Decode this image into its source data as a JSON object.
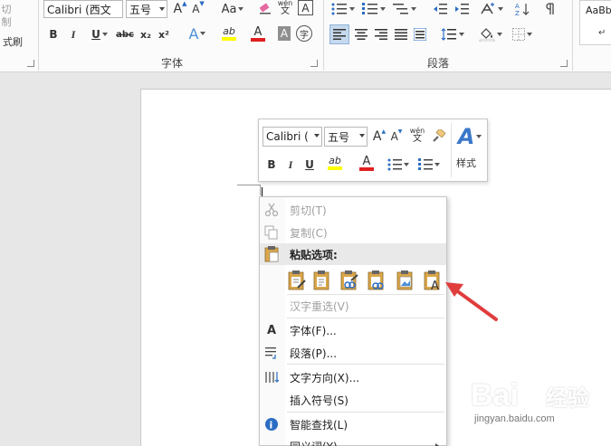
{
  "ribbon": {
    "clipboard_partial": {
      "cut": "切",
      "copy": "制",
      "format_painter": "式刷"
    },
    "font": {
      "font_name": "Calibri (西文",
      "font_size": "五号",
      "grow_label": "A",
      "shrink_label": "A",
      "change_case_label": "Aa",
      "phonetic_top": "wén",
      "phonetic_bottom": "文",
      "border_char_label": "A",
      "bold": "B",
      "italic": "I",
      "underline": "U",
      "strikethrough": "abc",
      "subscript": "x₂",
      "superscript": "x²",
      "text_effects": "A",
      "highlight": "ab",
      "font_color": "A",
      "char_shading": "A",
      "enclose_char": "字",
      "group_label": "字体"
    },
    "paragraph": {
      "group_label": "段落"
    },
    "styles": {
      "preview": "AaBb",
      "sub": "↵"
    }
  },
  "mini_toolbar": {
    "font_name": "Calibri (",
    "font_size": "五号",
    "grow_label": "A",
    "shrink_label": "A",
    "phonetic_top": "wén",
    "phonetic_bottom": "文",
    "bold": "B",
    "italic": "I",
    "underline": "U",
    "highlight": "ab",
    "font_color": "A",
    "styles_label": "样式",
    "styles_icon": "A"
  },
  "context_menu": {
    "cut": "剪切(T)",
    "copy": "复制(C)",
    "paste_options_header": "粘贴选项:",
    "reconvert": "汉字重选(V)",
    "font": "字体(F)...",
    "paragraph": "段落(P)...",
    "text_direction": "文字方向(X)...",
    "insert_symbol": "插入符号(S)",
    "smart_lookup": "智能查找(L)",
    "synonyms": "同义词(Y)",
    "font_icon": "A"
  },
  "colors": {
    "highlight_yellow": "#ffff00",
    "font_red": "#e02020",
    "arrow_red": "#e03c3c",
    "accent_blue": "#2b579a"
  },
  "watermark": {
    "logo": "Bai",
    "logo_suffix": "经验",
    "url": "jingyan.baidu.com"
  }
}
